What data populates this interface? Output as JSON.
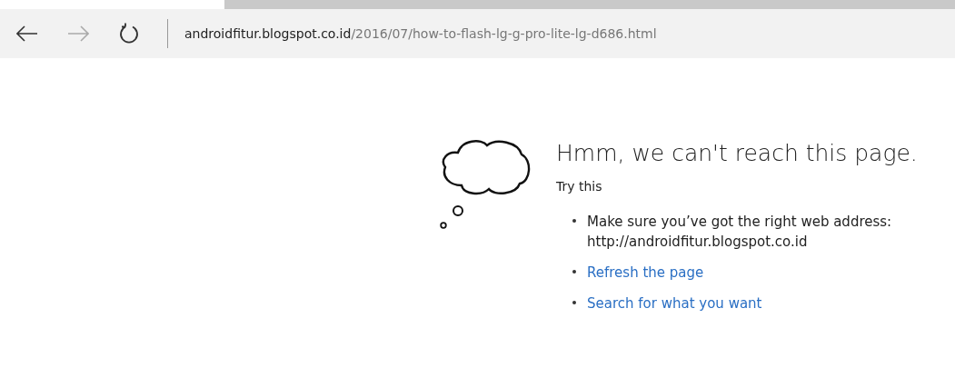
{
  "toolbar": {
    "address": {
      "host": "androidfitur.blogspot.co.id",
      "path": "/2016/07/how-to-flash-lg-g-pro-lite-lg-d686.html"
    },
    "forward_disabled": true
  },
  "error": {
    "title": "Hmm, we can't reach this page.",
    "subtitle": "Try this",
    "suggestions": [
      {
        "kind": "text",
        "lines": [
          "Make sure you’ve got the right web address:",
          "http://androidfitur.blogspot.co.id"
        ]
      },
      {
        "kind": "link",
        "text": "Refresh the page"
      },
      {
        "kind": "link",
        "text": "Search for what you want"
      }
    ]
  }
}
